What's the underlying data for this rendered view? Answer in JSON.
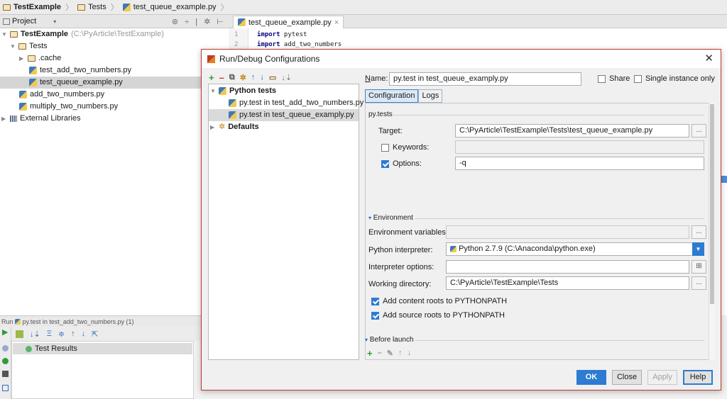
{
  "breadcrumb": {
    "project": "TestExample",
    "folder": "Tests",
    "file": "test_queue_example.py"
  },
  "project_panel": {
    "header": "Project",
    "tree": [
      {
        "label": "TestExample",
        "path": "(C:\\PyArticle\\TestExample)"
      },
      {
        "label": "Tests"
      },
      {
        "label": ".cache"
      },
      {
        "label": "test_add_two_numbers.py"
      },
      {
        "label": "test_queue_example.py"
      },
      {
        "label": "add_two_numbers.py"
      },
      {
        "label": "multiply_two_numbers.py"
      },
      {
        "label": "External Libraries"
      }
    ]
  },
  "editor": {
    "tab": "test_queue_example.py",
    "tab_close": "×",
    "lines": [
      {
        "num": "1",
        "kw": "import",
        "text": " pytest"
      },
      {
        "num": "2",
        "kw": "import",
        "text": " add_two_numbers"
      }
    ]
  },
  "run_panel": {
    "title": "Run",
    "config": "py.test in test_add_two_numbers.py (1)",
    "results_label": "Test Results"
  },
  "dialog": {
    "title": "Run/Debug Configurations",
    "close": "✕",
    "tree": [
      {
        "label": "Python tests"
      },
      {
        "label": "py.test in test_add_two_numbers.py"
      },
      {
        "label": "py.test in test_queue_examply.py"
      },
      {
        "label": "Defaults"
      }
    ],
    "name_label": "Name:",
    "name_value": "py.test in test_queue_examply.py",
    "share_label": "Share",
    "single_instance_label": "Single instance only",
    "tabs": [
      "Configuration",
      "Logs"
    ],
    "section_pytests": "py.tests",
    "target_label": "Target:",
    "target_value": "C:\\PyArticle\\TestExample\\Tests\\test_queue_example.py",
    "keywords_label": "Keywords:",
    "options_label": "Options:",
    "options_value": "-q",
    "environment_label": "Environment",
    "env_vars_label": "Environment variables:",
    "interpreter_label": "Python interpreter:",
    "interpreter_value": "Python 2.7.9 (C:\\Anaconda\\python.exe)",
    "interp_options_label": "Interpreter options:",
    "working_dir_label": "Working directory:",
    "working_dir_value": "C:\\PyArticle\\TestExample\\Tests",
    "content_roots_label": "Add content roots to PYTHONPATH",
    "source_roots_label": "Add source roots to PYTHONPATH",
    "before_launch_label": "Before launch",
    "buttons": {
      "ok": "OK",
      "close": "Close",
      "apply": "Apply",
      "help": "Help"
    },
    "ellipsis": "..."
  }
}
